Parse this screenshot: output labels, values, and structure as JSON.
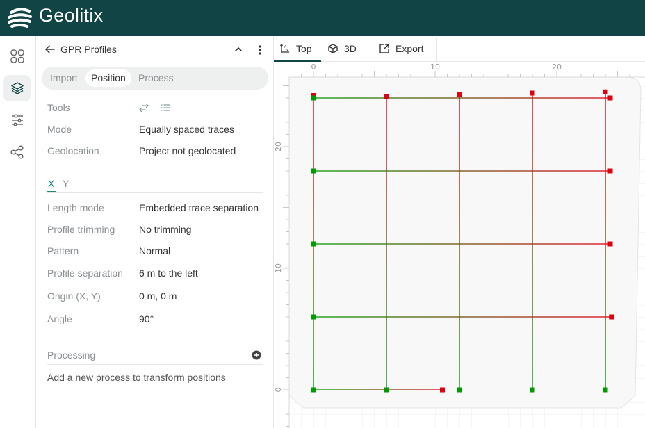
{
  "app": {
    "brand": "Geolitix",
    "brand_color": "#114545",
    "accent_color": "#1a8a7a"
  },
  "rail": {
    "items": [
      {
        "name": "dashboard",
        "icon": "grid-icon",
        "active": false
      },
      {
        "name": "layers",
        "icon": "layers-icon",
        "active": true
      },
      {
        "name": "settings",
        "icon": "sliders-icon",
        "active": false
      },
      {
        "name": "share",
        "icon": "share-icon",
        "active": false
      }
    ]
  },
  "panel": {
    "title": "GPR Profiles",
    "tabs": [
      {
        "label": "Import",
        "active": false
      },
      {
        "label": "Position",
        "active": true
      },
      {
        "label": "Process",
        "active": false
      }
    ],
    "general": [
      {
        "label": "Tools",
        "value": ""
      },
      {
        "label": "Mode",
        "value": "Equally spaced traces"
      },
      {
        "label": "Geolocation",
        "value": "Project not geolocated"
      }
    ],
    "axis_tabs": [
      {
        "label": "X",
        "active": true
      },
      {
        "label": "Y",
        "active": false
      }
    ],
    "axis_props": [
      {
        "label": "Length mode",
        "value": "Embedded trace separation"
      },
      {
        "label": "Profile trimming",
        "value": "No trimming"
      },
      {
        "label": "Pattern",
        "value": "Normal"
      },
      {
        "label": "Profile separation",
        "value": "6 m to the left"
      },
      {
        "label": "Origin (X, Y)",
        "value": "0 m, 0 m"
      },
      {
        "label": "Angle",
        "value": "90°"
      }
    ],
    "processing": {
      "label": "Processing",
      "hint": "Add a new process to transform positions"
    }
  },
  "viewer": {
    "tabs": [
      {
        "label": "Top",
        "icon": "axes-icon",
        "active": true
      },
      {
        "label": "3D",
        "icon": "cube-icon",
        "active": false
      }
    ],
    "export_label": "Export"
  },
  "chart_data": {
    "type": "line",
    "title": "",
    "xlabel": "",
    "ylabel": "",
    "x_ticks": [
      0,
      10,
      20
    ],
    "y_ticks": [
      0,
      10,
      20
    ],
    "xlim": [
      -0.5,
      27
    ],
    "ylim": [
      -3,
      26.5
    ],
    "start_color": "#009900",
    "end_color": "#dd0011",
    "series": [
      {
        "name": "profile-x0",
        "start": [
          0,
          0
        ],
        "end": [
          0,
          24.2
        ]
      },
      {
        "name": "profile-x6",
        "start": [
          6,
          0
        ],
        "end": [
          6,
          24.1
        ]
      },
      {
        "name": "profile-x12",
        "start": [
          12,
          0
        ],
        "end": [
          12,
          24.3
        ]
      },
      {
        "name": "profile-x18",
        "start": [
          18,
          0
        ],
        "end": [
          18,
          24.4
        ]
      },
      {
        "name": "profile-x24",
        "start": [
          24,
          0
        ],
        "end": [
          24,
          24.5
        ]
      },
      {
        "name": "profile-y0",
        "start": [
          0,
          0
        ],
        "end": [
          10.6,
          0
        ]
      },
      {
        "name": "profile-y6",
        "start": [
          0,
          6
        ],
        "end": [
          24.5,
          6
        ]
      },
      {
        "name": "profile-y12",
        "start": [
          0,
          12
        ],
        "end": [
          24.4,
          12
        ]
      },
      {
        "name": "profile-y18",
        "start": [
          0,
          18
        ],
        "end": [
          24.4,
          18
        ]
      },
      {
        "name": "profile-y24",
        "start": [
          0,
          24
        ],
        "end": [
          24.4,
          24
        ]
      }
    ]
  }
}
